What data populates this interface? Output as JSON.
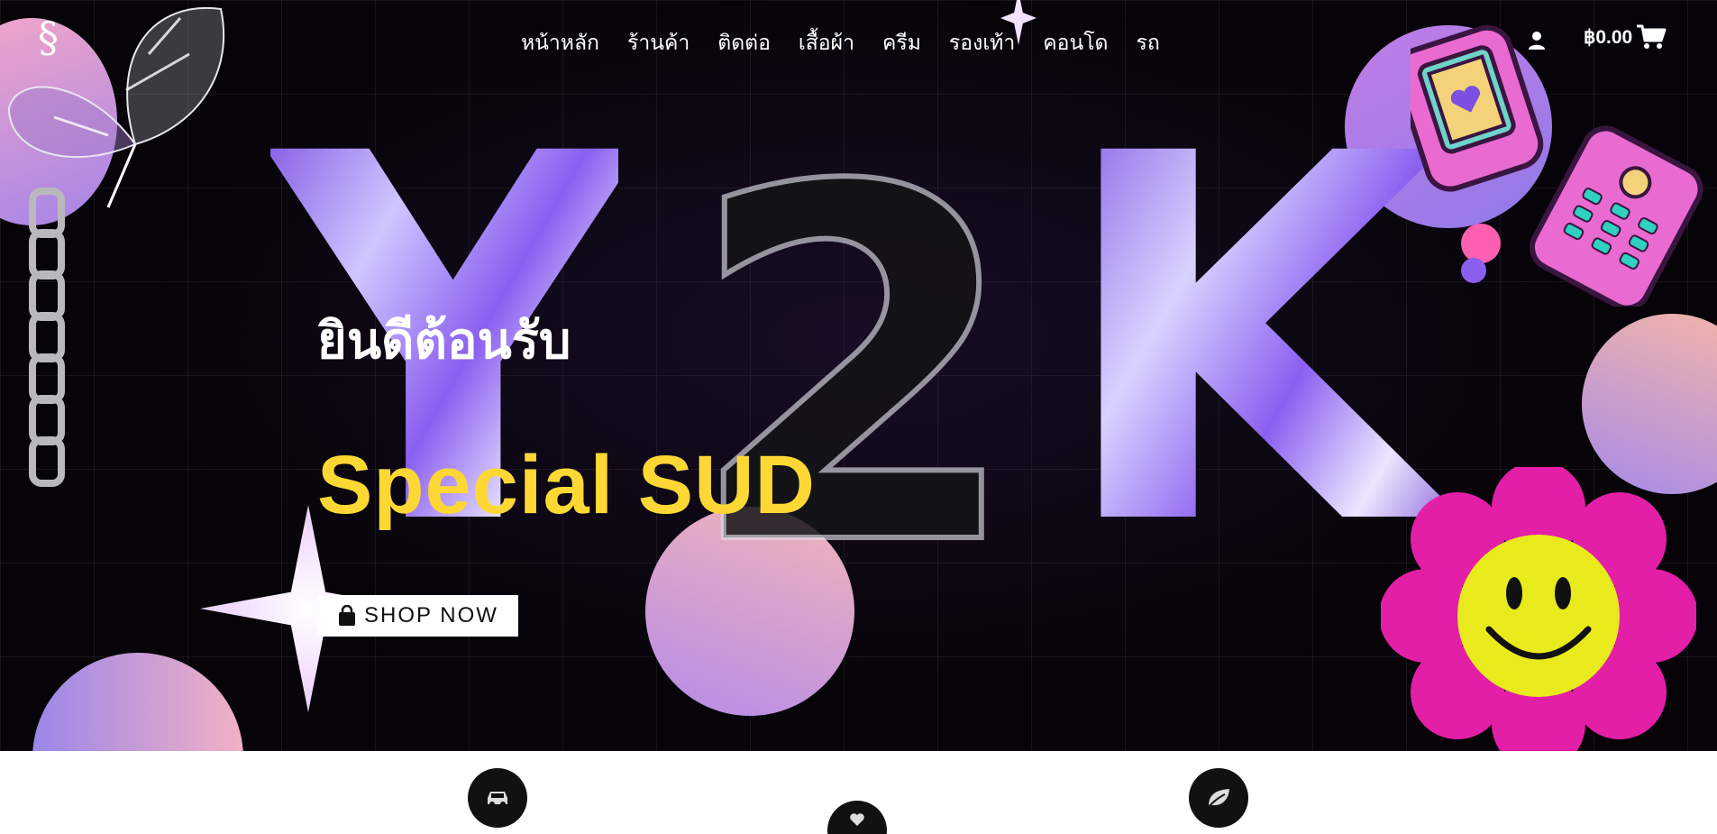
{
  "brand": {
    "logo_glyph": "§"
  },
  "nav": {
    "items": [
      {
        "label": "หน้าหลัก"
      },
      {
        "label": "ร้านค้า"
      },
      {
        "label": "ติดต่อ"
      },
      {
        "label": "เสื้อผ้า"
      },
      {
        "label": "ครีม"
      },
      {
        "label": "รองเท้า"
      },
      {
        "label": "คอนโด"
      },
      {
        "label": "รถ"
      }
    ]
  },
  "header": {
    "account_icon": "user-icon",
    "cart_total": "฿0.00",
    "cart_icon": "shopping-cart-icon"
  },
  "hero": {
    "decor_letters": {
      "y": "Y",
      "two": "2",
      "k": "K"
    },
    "welcome": "ยินดีต้อนรับ",
    "headline": "Special SUD",
    "shop_button": {
      "label": "SHOP NOW",
      "icon": "shopping-bag-icon"
    }
  },
  "features": [
    {
      "icon": "car-icon"
    },
    {
      "icon": "heart-icon"
    },
    {
      "icon": "leaf-icon"
    }
  ],
  "colors": {
    "hero_background": "#060409",
    "headline_yellow": "#fdd835",
    "nav_text": "#ffffff",
    "feature_circle": "#111111"
  }
}
